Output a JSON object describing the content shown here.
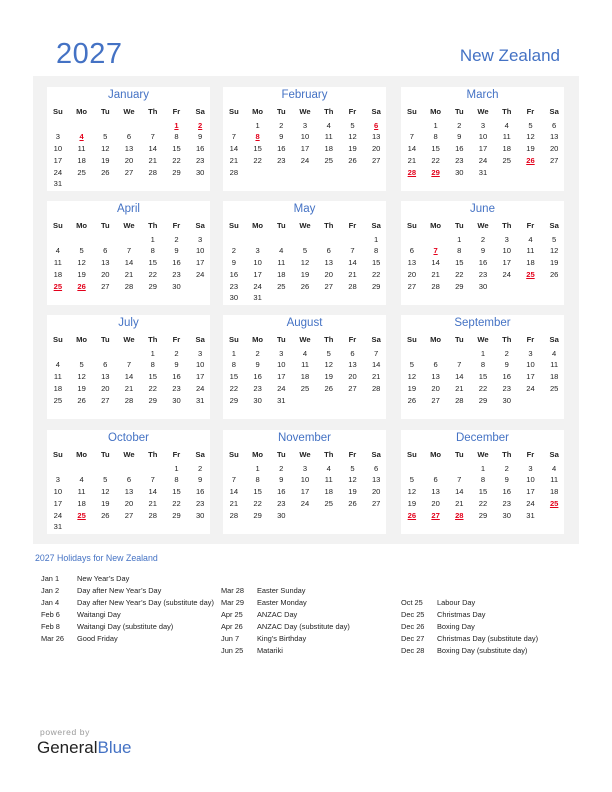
{
  "header": {
    "year": "2027",
    "country": "New Zealand"
  },
  "colors": {
    "accent": "#4472C4",
    "holiday": "#e3001b",
    "panel": "#f2f2f2"
  },
  "weekday_headers": [
    "Su",
    "Mo",
    "Tu",
    "We",
    "Th",
    "Fr",
    "Sa"
  ],
  "months": [
    {
      "name": "January",
      "holidays": [
        1,
        2,
        4
      ],
      "weeks": [
        [
          null,
          null,
          null,
          null,
          null,
          1,
          2
        ],
        [
          3,
          4,
          5,
          6,
          7,
          8,
          9
        ],
        [
          10,
          11,
          12,
          13,
          14,
          15,
          16
        ],
        [
          17,
          18,
          19,
          20,
          21,
          22,
          23
        ],
        [
          24,
          25,
          26,
          27,
          28,
          29,
          30
        ],
        [
          31,
          null,
          null,
          null,
          null,
          null,
          null
        ]
      ]
    },
    {
      "name": "February",
      "holidays": [
        6,
        8
      ],
      "weeks": [
        [
          null,
          1,
          2,
          3,
          4,
          5,
          6
        ],
        [
          7,
          8,
          9,
          10,
          11,
          12,
          13
        ],
        [
          14,
          15,
          16,
          17,
          18,
          19,
          20
        ],
        [
          21,
          22,
          23,
          24,
          25,
          26,
          27
        ],
        [
          28,
          null,
          null,
          null,
          null,
          null,
          null
        ]
      ]
    },
    {
      "name": "March",
      "holidays": [
        26,
        28,
        29
      ],
      "weeks": [
        [
          null,
          1,
          2,
          3,
          4,
          5,
          6
        ],
        [
          7,
          8,
          9,
          10,
          11,
          12,
          13
        ],
        [
          14,
          15,
          16,
          17,
          18,
          19,
          20
        ],
        [
          21,
          22,
          23,
          24,
          25,
          26,
          27
        ],
        [
          28,
          29,
          30,
          31,
          null,
          null,
          null
        ]
      ]
    },
    {
      "name": "April",
      "holidays": [
        25,
        26
      ],
      "weeks": [
        [
          null,
          null,
          null,
          null,
          1,
          2,
          3
        ],
        [
          4,
          5,
          6,
          7,
          8,
          9,
          10
        ],
        [
          11,
          12,
          13,
          14,
          15,
          16,
          17
        ],
        [
          18,
          19,
          20,
          21,
          22,
          23,
          24
        ],
        [
          25,
          26,
          27,
          28,
          29,
          30,
          null
        ]
      ]
    },
    {
      "name": "May",
      "holidays": [],
      "weeks": [
        [
          null,
          null,
          null,
          null,
          null,
          null,
          1
        ],
        [
          2,
          3,
          4,
          5,
          6,
          7,
          8
        ],
        [
          9,
          10,
          11,
          12,
          13,
          14,
          15
        ],
        [
          16,
          17,
          18,
          19,
          20,
          21,
          22
        ],
        [
          23,
          24,
          25,
          26,
          27,
          28,
          29
        ],
        [
          30,
          31,
          null,
          null,
          null,
          null,
          null
        ]
      ]
    },
    {
      "name": "June",
      "holidays": [
        7,
        25
      ],
      "weeks": [
        [
          null,
          null,
          1,
          2,
          3,
          4,
          5
        ],
        [
          6,
          7,
          8,
          9,
          10,
          11,
          12
        ],
        [
          13,
          14,
          15,
          16,
          17,
          18,
          19
        ],
        [
          20,
          21,
          22,
          23,
          24,
          25,
          26
        ],
        [
          27,
          28,
          29,
          30,
          null,
          null,
          null
        ]
      ]
    },
    {
      "name": "July",
      "holidays": [],
      "weeks": [
        [
          null,
          null,
          null,
          null,
          1,
          2,
          3
        ],
        [
          4,
          5,
          6,
          7,
          8,
          9,
          10
        ],
        [
          11,
          12,
          13,
          14,
          15,
          16,
          17
        ],
        [
          18,
          19,
          20,
          21,
          22,
          23,
          24
        ],
        [
          25,
          26,
          27,
          28,
          29,
          30,
          31
        ]
      ]
    },
    {
      "name": "August",
      "holidays": [],
      "weeks": [
        [
          1,
          2,
          3,
          4,
          5,
          6,
          7
        ],
        [
          8,
          9,
          10,
          11,
          12,
          13,
          14
        ],
        [
          15,
          16,
          17,
          18,
          19,
          20,
          21
        ],
        [
          22,
          23,
          24,
          25,
          26,
          27,
          28
        ],
        [
          29,
          30,
          31,
          null,
          null,
          null,
          null
        ]
      ]
    },
    {
      "name": "September",
      "holidays": [],
      "weeks": [
        [
          null,
          null,
          null,
          1,
          2,
          3,
          4
        ],
        [
          5,
          6,
          7,
          8,
          9,
          10,
          11
        ],
        [
          12,
          13,
          14,
          15,
          16,
          17,
          18
        ],
        [
          19,
          20,
          21,
          22,
          23,
          24,
          25
        ],
        [
          26,
          27,
          28,
          29,
          30,
          null,
          null
        ]
      ]
    },
    {
      "name": "October",
      "holidays": [
        25
      ],
      "weeks": [
        [
          null,
          null,
          null,
          null,
          null,
          1,
          2
        ],
        [
          3,
          4,
          5,
          6,
          7,
          8,
          9
        ],
        [
          10,
          11,
          12,
          13,
          14,
          15,
          16
        ],
        [
          17,
          18,
          19,
          20,
          21,
          22,
          23
        ],
        [
          24,
          25,
          26,
          27,
          28,
          29,
          30
        ],
        [
          31,
          null,
          null,
          null,
          null,
          null,
          null
        ]
      ]
    },
    {
      "name": "November",
      "holidays": [],
      "weeks": [
        [
          null,
          1,
          2,
          3,
          4,
          5,
          6
        ],
        [
          7,
          8,
          9,
          10,
          11,
          12,
          13
        ],
        [
          14,
          15,
          16,
          17,
          18,
          19,
          20
        ],
        [
          21,
          22,
          23,
          24,
          25,
          26,
          27
        ],
        [
          28,
          29,
          30,
          null,
          null,
          null,
          null
        ]
      ]
    },
    {
      "name": "December",
      "holidays": [
        25,
        26,
        27,
        28
      ],
      "weeks": [
        [
          null,
          null,
          null,
          1,
          2,
          3,
          4
        ],
        [
          5,
          6,
          7,
          8,
          9,
          10,
          11
        ],
        [
          12,
          13,
          14,
          15,
          16,
          17,
          18
        ],
        [
          19,
          20,
          21,
          22,
          23,
          24,
          25
        ],
        [
          26,
          27,
          28,
          29,
          30,
          31,
          null
        ]
      ]
    }
  ],
  "holiday_list": {
    "title": "2027 Holidays for New Zealand",
    "columns": [
      [
        {
          "date": "Jan 1",
          "name": "New Year’s Day"
        },
        {
          "date": "Jan 2",
          "name": "Day after New Year’s Day"
        },
        {
          "date": "Jan 4",
          "name": "Day after New Year’s Day (substitute day)"
        },
        {
          "date": "Feb 6",
          "name": "Waitangi Day"
        },
        {
          "date": "Feb 8",
          "name": "Waitangi Day (substitute day)"
        },
        {
          "date": "Mar 26",
          "name": "Good Friday"
        }
      ],
      [
        {
          "date": "Mar 28",
          "name": "Easter Sunday"
        },
        {
          "date": "Mar 29",
          "name": "Easter Monday"
        },
        {
          "date": "Apr 25",
          "name": "ANZAC Day"
        },
        {
          "date": "Apr 26",
          "name": "ANZAC Day (substitute day)"
        },
        {
          "date": "Jun 7",
          "name": "King’s Birthday"
        },
        {
          "date": "Jun 25",
          "name": "Matariki"
        }
      ],
      [
        {
          "date": "Oct 25",
          "name": "Labour Day"
        },
        {
          "date": "Dec 25",
          "name": "Christmas Day"
        },
        {
          "date": "Dec 26",
          "name": "Boxing Day"
        },
        {
          "date": "Dec 27",
          "name": "Christmas Day (substitute day)"
        },
        {
          "date": "Dec 28",
          "name": "Boxing Day (substitute day)"
        }
      ]
    ]
  },
  "footer": {
    "powered_by": "powered by",
    "brand_part1": "General",
    "brand_part2": "Blue"
  }
}
